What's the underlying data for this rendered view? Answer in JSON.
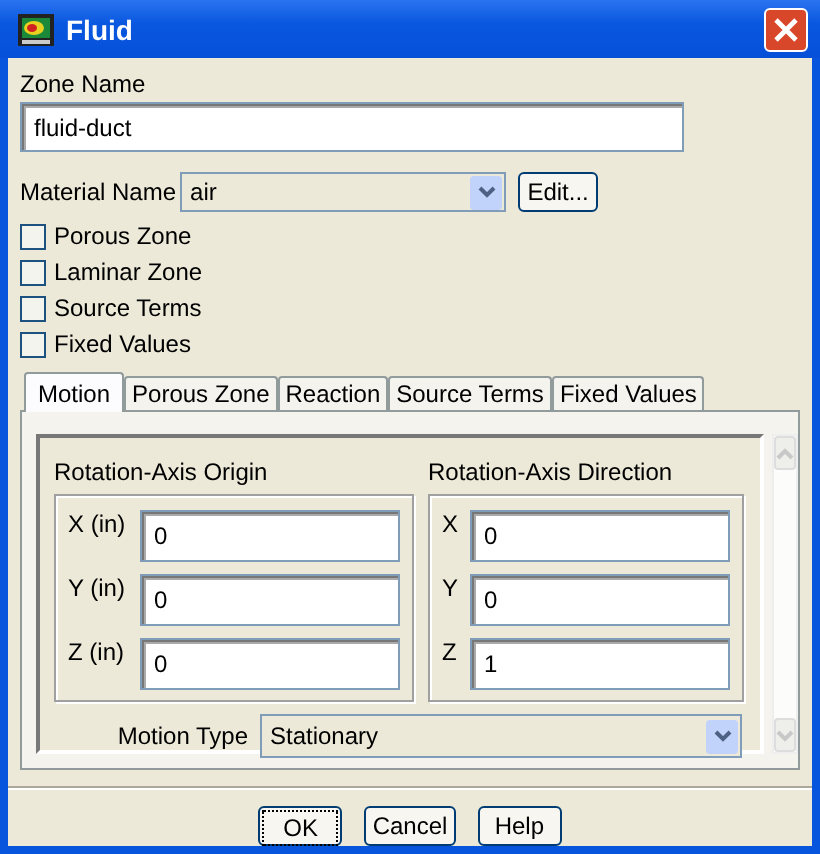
{
  "window": {
    "title": "Fluid"
  },
  "zone_name": {
    "label": "Zone Name",
    "value": "fluid-duct"
  },
  "material": {
    "label": "Material Name",
    "value": "air",
    "edit_button": "Edit..."
  },
  "options": [
    {
      "label": "Porous Zone",
      "checked": false
    },
    {
      "label": "Laminar Zone",
      "checked": false
    },
    {
      "label": "Source Terms",
      "checked": false
    },
    {
      "label": "Fixed Values",
      "checked": false
    }
  ],
  "tabs": [
    {
      "label": "Motion",
      "selected": true
    },
    {
      "label": "Porous Zone",
      "selected": false
    },
    {
      "label": "Reaction",
      "selected": false
    },
    {
      "label": "Source Terms",
      "selected": false
    },
    {
      "label": "Fixed Values",
      "selected": false
    }
  ],
  "groups": [
    {
      "title": "Rotation-Axis Origin",
      "fields": [
        {
          "label": "X (in)",
          "value": "0"
        },
        {
          "label": "Y (in)",
          "value": "0"
        },
        {
          "label": "Z (in)",
          "value": "0"
        }
      ]
    },
    {
      "title": "Rotation-Axis Direction",
      "fields": [
        {
          "label": "X",
          "value": "0"
        },
        {
          "label": "Y",
          "value": "0"
        },
        {
          "label": "Z",
          "value": "1"
        }
      ]
    }
  ],
  "motion_type": {
    "label": "Motion Type",
    "value": "Stationary"
  },
  "buttons": [
    {
      "label": "OK",
      "focused": true
    },
    {
      "label": "Cancel",
      "focused": false
    },
    {
      "label": "Help",
      "focused": false
    }
  ]
}
